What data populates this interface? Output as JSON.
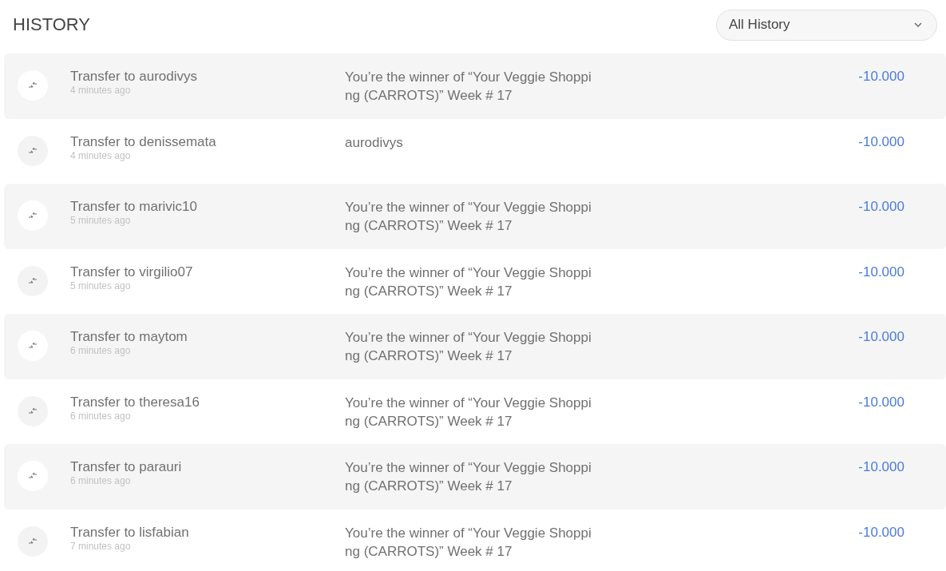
{
  "title": "HISTORY",
  "filter": {
    "value": "All History"
  },
  "transactions": [
    {
      "name": "Transfer to aurodivys",
      "time": "4 minutes ago",
      "memo": [
        "You’re the winner of “Your Veggie Shoppi",
        "ng (CARROTS)” Week # 17"
      ],
      "amount": "-10.000"
    },
    {
      "name": "Transfer to denissemata",
      "time": "4 minutes ago",
      "memo": [
        "aurodivys"
      ],
      "amount": "-10.000"
    },
    {
      "name": "Transfer to marivic10",
      "time": "5 minutes ago",
      "memo": [
        "You’re the winner of “Your Veggie Shoppi",
        "ng (CARROTS)” Week # 17"
      ],
      "amount": "-10.000"
    },
    {
      "name": "Transfer to virgilio07",
      "time": "5 minutes ago",
      "memo": [
        "You’re the winner of “Your Veggie Shoppi",
        "ng (CARROTS)” Week # 17"
      ],
      "amount": "-10.000"
    },
    {
      "name": "Transfer to maytom",
      "time": "6 minutes ago",
      "memo": [
        "You’re the winner of “Your Veggie Shoppi",
        "ng (CARROTS)” Week # 17"
      ],
      "amount": "-10.000"
    },
    {
      "name": "Transfer to theresa16",
      "time": "6 minutes ago",
      "memo": [
        "You’re the winner of “Your Veggie Shoppi",
        "ng (CARROTS)” Week # 17"
      ],
      "amount": "-10.000"
    },
    {
      "name": "Transfer to parauri",
      "time": "6 minutes ago",
      "memo": [
        "You’re the winner of “Your Veggie Shoppi",
        "ng (CARROTS)” Week # 17"
      ],
      "amount": "-10.000"
    },
    {
      "name": "Transfer to lisfabian",
      "time": "7 minutes ago",
      "memo": [
        "You’re the winner of “Your Veggie Shoppi",
        "ng (CARROTS)” Week # 17"
      ],
      "amount": "-10.000"
    }
  ]
}
